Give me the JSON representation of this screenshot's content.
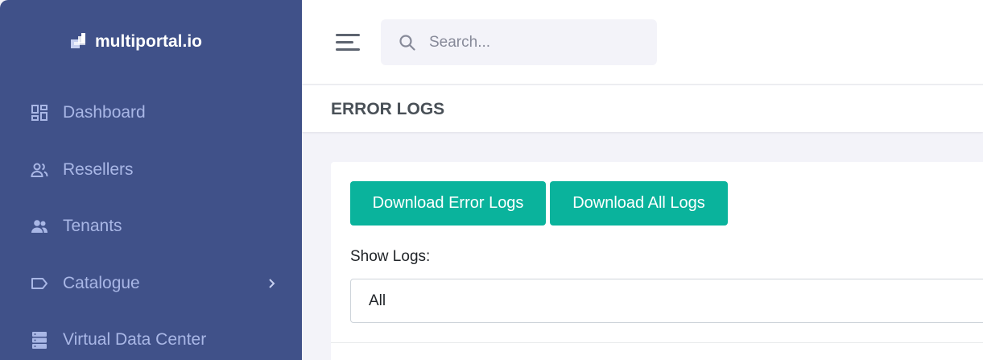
{
  "brand": {
    "name": "multiportal.io"
  },
  "sidebar": {
    "items": [
      {
        "label": "Dashboard",
        "icon": "dashboard-icon"
      },
      {
        "label": "Resellers",
        "icon": "resellers-icon"
      },
      {
        "label": "Tenants",
        "icon": "tenants-icon"
      },
      {
        "label": "Catalogue",
        "icon": "tag-icon",
        "has_submenu": true
      },
      {
        "label": "Virtual Data Center",
        "icon": "server-icon"
      }
    ]
  },
  "topbar": {
    "search": {
      "placeholder": "Search...",
      "value": ""
    }
  },
  "page": {
    "title": "ERROR LOGS"
  },
  "card": {
    "buttons": {
      "download_error": "Download Error Logs",
      "download_all": "Download All Logs"
    },
    "show_logs_label": "Show Logs:",
    "show_logs_value": "All"
  },
  "colors": {
    "sidebar_bg": "#405189",
    "sidebar_text": "#a9b7e6",
    "accent": "#0ab39c",
    "page_bg": "#f3f3f9"
  }
}
